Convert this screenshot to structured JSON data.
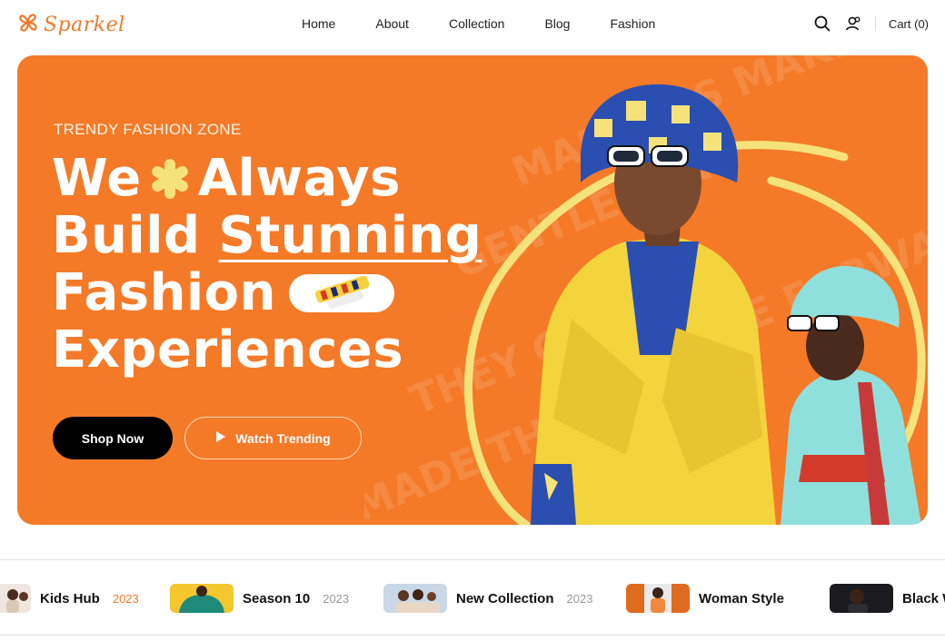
{
  "brand": {
    "name": "Sparkel",
    "logo_icon": "flower-logo-icon",
    "color": "#f07a2b"
  },
  "nav": {
    "items": [
      "Home",
      "About",
      "Collection",
      "Blog",
      "Fashion"
    ]
  },
  "header_tools": {
    "search_icon": "search-icon",
    "user_icon": "user-icon",
    "cart_label": "Cart (0)"
  },
  "hero": {
    "eyebrow": "TRENDY FASHION ZONE",
    "line1_a": "We",
    "line1_b": "Always",
    "line2_a": "Build",
    "line2_b": "Stunning",
    "line3": "Fashion",
    "line4": "Experiences",
    "primary_button": "Shop Now",
    "secondary_button": "Watch Trending",
    "bg_color": "#f47a28",
    "accent_color": "#f6e27a"
  },
  "categories": [
    {
      "name": "Kids Hub",
      "year": "2023",
      "year_color": "#f07a2b"
    },
    {
      "name": "Season 10",
      "year": "2023",
      "year_color": "#9a9a9a"
    },
    {
      "name": "New Collection",
      "year": "2023",
      "year_color": "#9a9a9a"
    },
    {
      "name": "Woman Style",
      "year": "",
      "year_color": "#9a9a9a"
    },
    {
      "name": "Black W",
      "year": "",
      "year_color": "#9a9a9a"
    }
  ]
}
